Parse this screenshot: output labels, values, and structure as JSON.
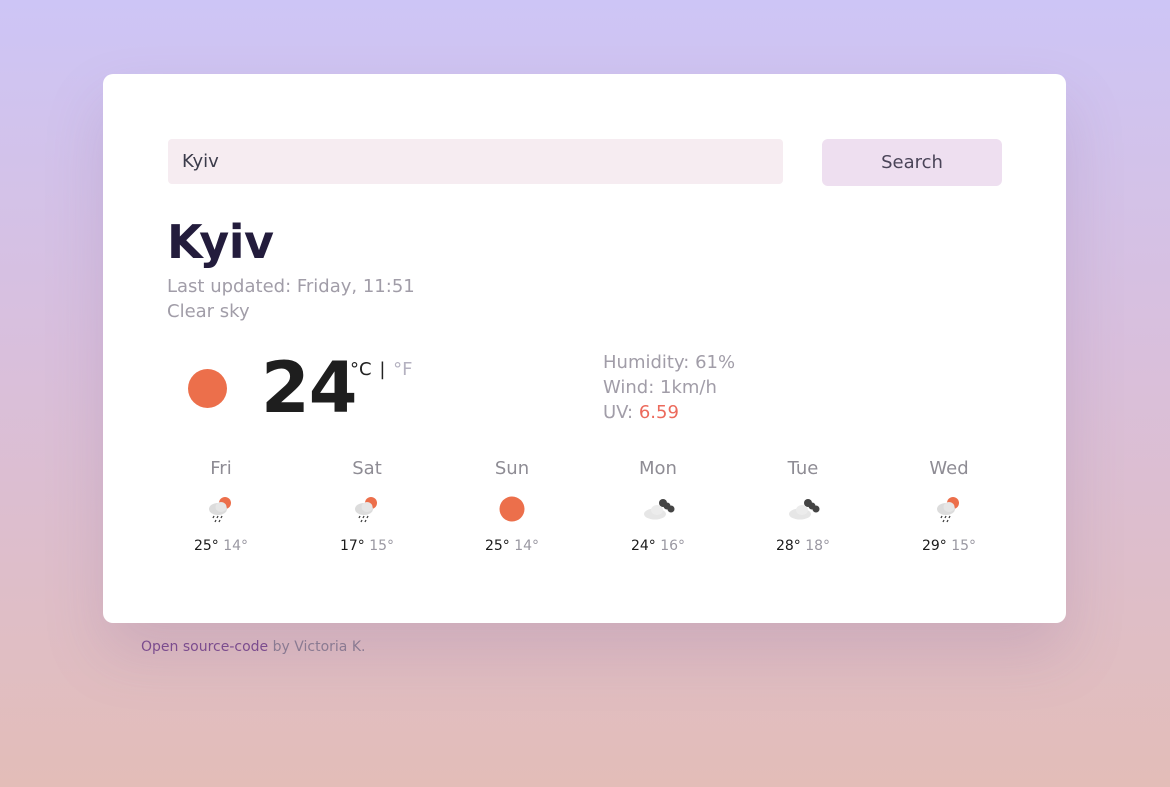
{
  "search": {
    "value": "Kyiv",
    "button_label": "Search"
  },
  "current": {
    "city": "Kyiv",
    "last_updated": "Last updated: Friday, 11:51",
    "description": "Clear sky",
    "icon": "sun-icon",
    "temperature": "24",
    "unit_c": "°C",
    "unit_separator": "|",
    "unit_f": "°F",
    "humidity_label": "Humidity: 61%",
    "wind_label": "Wind: 1km/h",
    "uv_label": "UV: ",
    "uv_value": "6.59"
  },
  "forecast": [
    {
      "day": "Fri",
      "icon": "rain-sun-icon",
      "max": "25°",
      "min": "14°"
    },
    {
      "day": "Sat",
      "icon": "rain-sun-icon",
      "max": "17°",
      "min": "15°"
    },
    {
      "day": "Sun",
      "icon": "sun-icon",
      "max": "25°",
      "min": "14°"
    },
    {
      "day": "Mon",
      "icon": "clouds-icon",
      "max": "24°",
      "min": "16°"
    },
    {
      "day": "Tue",
      "icon": "clouds-icon",
      "max": "28°",
      "min": "18°"
    },
    {
      "day": "Wed",
      "icon": "rain-sun-icon",
      "max": "29°",
      "min": "15°"
    }
  ],
  "footer": {
    "link_text": "Open source-code",
    "suffix": " by Victoria K."
  },
  "colors": {
    "accent": "#ec6f4b",
    "uv": "#ec6a5c",
    "city": "#231c3c",
    "muted": "#a19da8"
  }
}
